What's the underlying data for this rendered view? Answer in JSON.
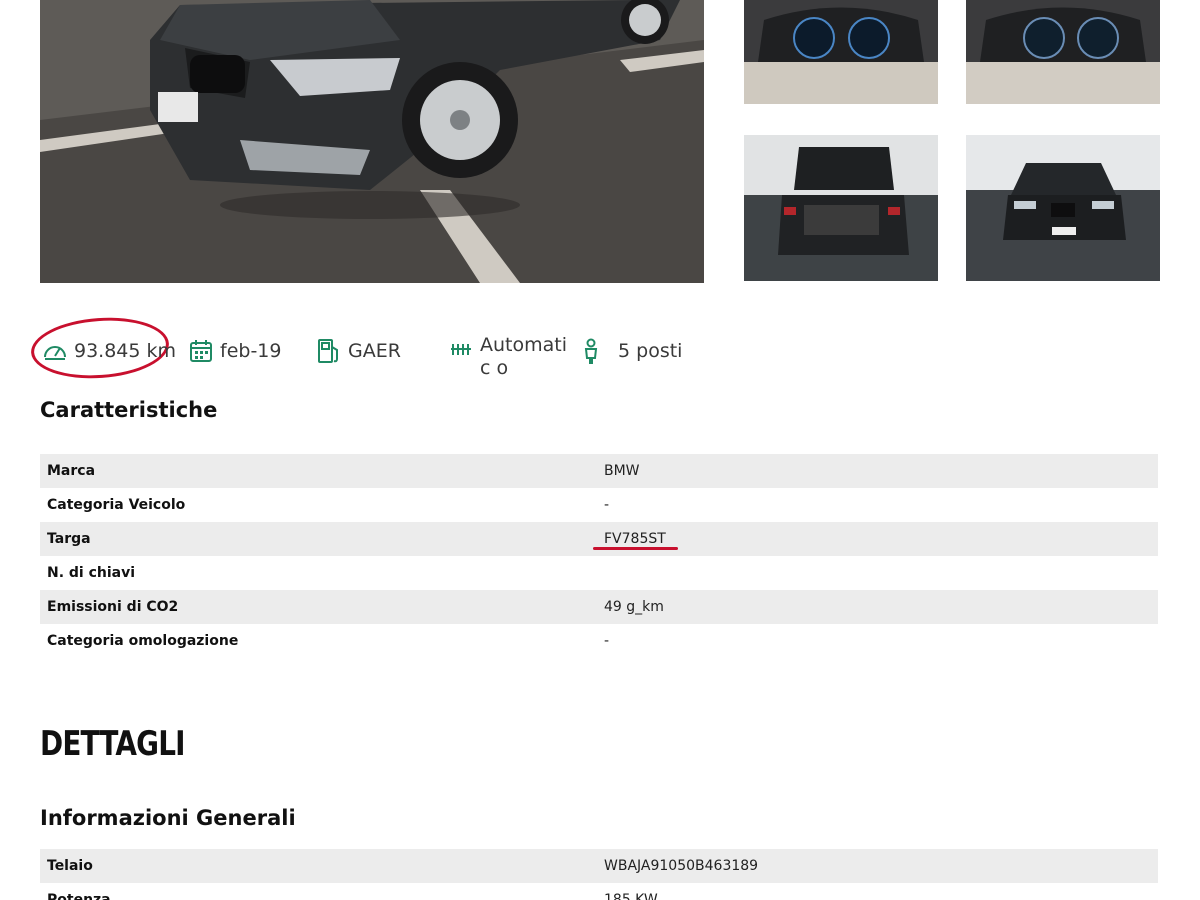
{
  "gallery": {
    "main_photo": "front three-quarter view of dark grey BMW sedan in parking lot",
    "thumbnails": [
      {
        "icon": "instrument-cluster-photo"
      },
      {
        "icon": "instrument-cluster-photo"
      },
      {
        "icon": "open-trunk-rear-photo"
      },
      {
        "icon": "front-view-photo"
      }
    ]
  },
  "specs": {
    "mileage": "93.845 km",
    "registration_date": "feb-19",
    "fuel": "GAER",
    "transmission": "Automatic o",
    "seats": "5 posti",
    "icon_color": "#1f8a64"
  },
  "caratteristiche": {
    "title": "Caratteristiche",
    "rows": [
      {
        "label": "Marca",
        "value": "BMW"
      },
      {
        "label": "Categoria Veicolo",
        "value": "-"
      },
      {
        "label": "Targa",
        "value": "FV785ST"
      },
      {
        "label": "N. di chiavi",
        "value": ""
      },
      {
        "label": "Emissioni di CO2",
        "value": "49 g_km"
      },
      {
        "label": "Categoria omologazione",
        "value": "-"
      }
    ]
  },
  "dettagli": {
    "title": "DETTAGLI",
    "section_title": "Informazioni Generali",
    "rows": [
      {
        "label": "Telaio",
        "value": "WBAJA91050B463189"
      },
      {
        "label": "Potenza",
        "value": "185 KW"
      }
    ]
  },
  "annotations": {
    "highlight_color": "#c8102e"
  }
}
